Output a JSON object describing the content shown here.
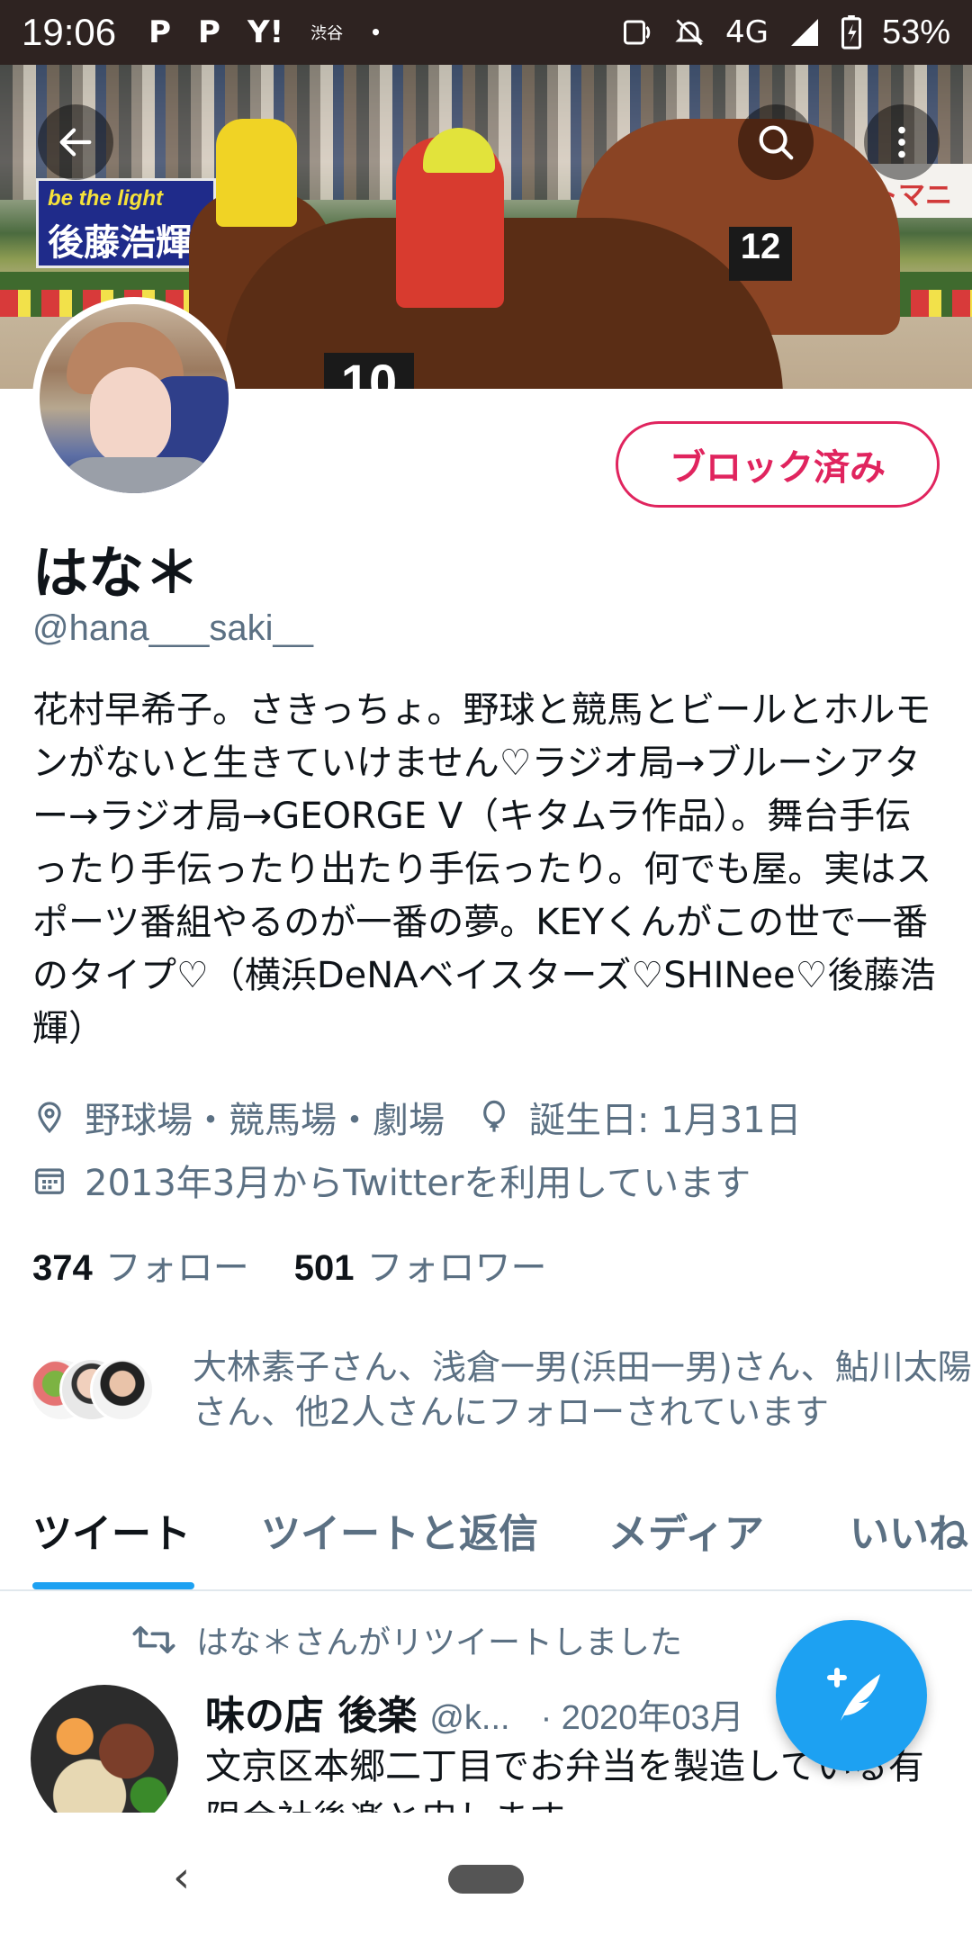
{
  "status_bar": {
    "time": "19:06",
    "left_icons": [
      "P",
      "P",
      "Y!",
      "渋谷",
      "•"
    ],
    "network": "4G",
    "battery": "53%"
  },
  "banner": {
    "sign_left_line1": "be the light",
    "sign_left_line2": "後藤浩輝",
    "sign_right": "トマニッ",
    "saddle_number": "10",
    "saddle_number_2": "12"
  },
  "profile": {
    "blocked_label": "ブロック済み",
    "display_name": "はな＊",
    "handle": "@hana___saki__",
    "bio": "花村早希子。さきっちょ。野球と競馬とビールとホルモンがないと生きていけません♡ラジオ局→ブルーシアター→ラジオ局→GEORGE V（キタムラ作品）。舞台手伝ったり手伝ったり出たり手伝ったり。何でも屋。実はスポーツ番組やるのが一番の夢。KEYくんがこの世で一番のタイプ♡（横浜DeNAベイスターズ♡SHINee♡後藤浩輝）",
    "location": "野球場・競馬場・劇場",
    "birthday": "誕生日: 1月31日",
    "joined": "2013年3月からTwitterを利用しています",
    "following_count": "374",
    "following_label": "フォロー",
    "followers_count": "501",
    "followers_label": "フォロワー",
    "followed_by": "大林素子さん、浅倉一男(浜田一男)さん、鮎川太陽さん、他2人さんにフォローされています"
  },
  "tabs": [
    {
      "label": "ツイート"
    },
    {
      "label": "ツイートと返信"
    },
    {
      "label": "メディア"
    },
    {
      "label": "いいね"
    }
  ],
  "tweet": {
    "retweet_note": "はな＊さんがリツイートしました",
    "name": "味の店 後楽",
    "handle": "@k...",
    "date": "· 2020年03月",
    "text": "文京区本郷二丁目でお弁当を製造している有限会社後楽と申します"
  },
  "colors": {
    "accent": "#1da1f2",
    "blocked": "#e0245e",
    "secondary_text": "#5b7083",
    "status_bar": "#2e2321"
  },
  "icons": {
    "back": "arrow-left-icon",
    "search": "search-icon",
    "more": "more-vertical-icon",
    "location": "location-pin-icon",
    "birthday": "balloon-icon",
    "calendar": "calendar-icon",
    "retweet": "retweet-icon",
    "compose": "compose-tweet-icon"
  }
}
